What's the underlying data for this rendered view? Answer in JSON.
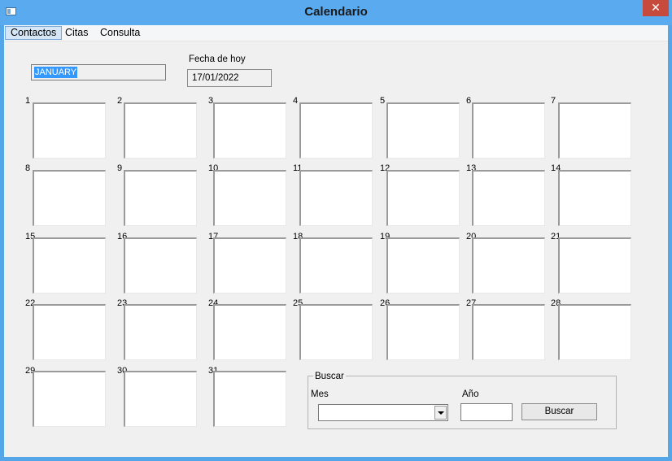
{
  "window": {
    "title": "Calendario",
    "close_glyph": "✕",
    "icon": "app-window-icon"
  },
  "menu": {
    "items": [
      "Contactos",
      "Citas",
      "Consulta"
    ],
    "active": "Contactos"
  },
  "month_field": {
    "value": "JANUARY",
    "selected": true
  },
  "today": {
    "label": "Fecha de hoy",
    "value": "17/01/2022"
  },
  "days": [
    "1",
    "2",
    "3",
    "4",
    "5",
    "6",
    "7",
    "8",
    "9",
    "10",
    "11",
    "12",
    "13",
    "14",
    "15",
    "16",
    "17",
    "18",
    "19",
    "20",
    "21",
    "22",
    "23",
    "24",
    "25",
    "26",
    "27",
    "28",
    "29",
    "30",
    "31"
  ],
  "search": {
    "group_title": "Buscar",
    "month_label": "Mes",
    "month_value": "",
    "year_label": "Año",
    "year_value": "",
    "button_label": "Buscar"
  }
}
